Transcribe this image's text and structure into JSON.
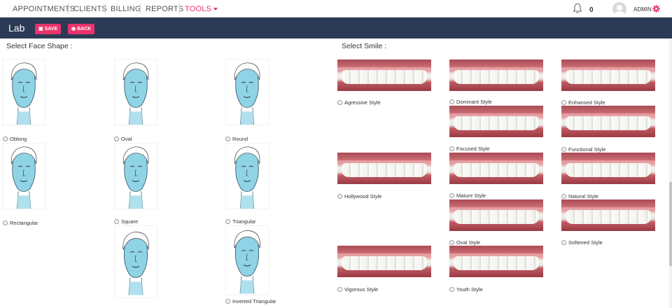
{
  "nav": {
    "items": [
      "APPOINTMENTS",
      "CLIENTS",
      "BILLING",
      "REPORTS"
    ],
    "tools_label": "TOOLS",
    "notifications_count": "0",
    "user_label": "ADMIN"
  },
  "header": {
    "title": "Lab",
    "save_label": "SAVE",
    "back_label": "BACK"
  },
  "face_section": {
    "label": "Select Face Shape :",
    "options": [
      "Oblong",
      "Oval",
      "Round",
      "Rectangular",
      "Square",
      "Triangular",
      "Inverted Triangular"
    ]
  },
  "smile_section": {
    "label": "Select Smile :",
    "options": [
      "Agressive Style",
      "Dominant Style",
      "Enhansed Style",
      "Focused Style",
      "Functional Style",
      "Hollywood Style",
      "Mature Style",
      "Natural Style",
      "Oval Style",
      "Softened Style",
      "Vigorous Style",
      "Youth Style"
    ]
  },
  "colors": {
    "accent": "#e8336c",
    "header_bg": "#2b3a55",
    "face_fill": "#8fd3e6"
  },
  "icons": [
    "bell-icon",
    "gear-icon",
    "save-icon",
    "back-icon",
    "avatar"
  ]
}
